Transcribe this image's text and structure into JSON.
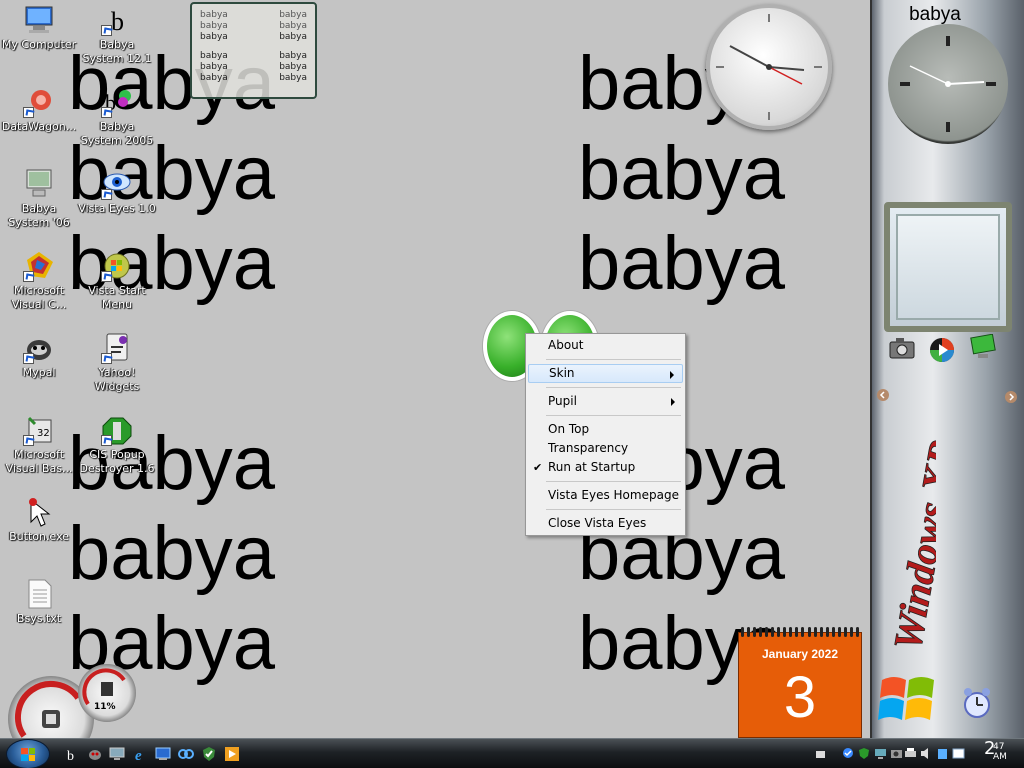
{
  "wallpaper": {
    "word": "babya"
  },
  "desktop_icons": [
    {
      "label": "My Computer",
      "icon": "computer-icon"
    },
    {
      "label": "Babya System 12.1",
      "icon": "babya-icon"
    },
    {
      "label": "DataWagon...",
      "icon": "datawagon-icon"
    },
    {
      "label": "Babya System 2005",
      "icon": "babya-2005-icon"
    },
    {
      "label": "Babya System '06",
      "icon": "babya-06-icon"
    },
    {
      "label": "Vista Eyes 1.0",
      "icon": "vista-eyes-icon"
    },
    {
      "label": "Microsoft Visual C...",
      "icon": "visual-c-icon"
    },
    {
      "label": "Vista Start Menu",
      "icon": "vista-start-menu-icon"
    },
    {
      "label": "Mypal",
      "icon": "mypal-icon"
    },
    {
      "label": "Yahoo! Widgets",
      "icon": "yahoo-widgets-icon"
    },
    {
      "label": "Microsoft Visual Bas...",
      "icon": "visual-basic-icon"
    },
    {
      "label": "CIS Popup Destroyer 1.6",
      "icon": "popup-destroyer-icon"
    },
    {
      "label": "Button.exe",
      "icon": "button-exe-icon"
    },
    {
      "label": "Bsys.txt",
      "icon": "text-file-icon"
    }
  ],
  "text_widget": {
    "rows": [
      [
        "babya",
        "babya"
      ],
      [
        "babya",
        "babya"
      ],
      [
        "babya",
        "babya"
      ],
      [
        "babya",
        "babya"
      ],
      [
        "babya",
        "babya"
      ],
      [
        "babya",
        "babya"
      ]
    ]
  },
  "sidebar": {
    "title": "babya"
  },
  "calendar": {
    "month": "January 2022",
    "day": "3"
  },
  "context_menu": {
    "items": [
      {
        "label": "About",
        "submenu": false,
        "checked": false,
        "highlighted": false
      },
      {
        "label": "Skin",
        "submenu": true,
        "checked": false,
        "highlighted": true
      },
      {
        "label": "Pupil",
        "submenu": true,
        "checked": false,
        "highlighted": false
      },
      {
        "label": "On Top",
        "submenu": false,
        "checked": false,
        "highlighted": false
      },
      {
        "label": "Transparency",
        "submenu": false,
        "checked": false,
        "highlighted": false
      },
      {
        "label": "Run at Startup",
        "submenu": false,
        "checked": true,
        "highlighted": false
      },
      {
        "label": "Vista Eyes Homepage",
        "submenu": false,
        "checked": false,
        "highlighted": false
      },
      {
        "label": "Close Vista Eyes",
        "submenu": false,
        "checked": false,
        "highlighted": false
      }
    ],
    "check_glyph": "✔"
  },
  "gadgets": {
    "cpu_meter_percent": "11%"
  },
  "taskbar": {
    "clock_hour": "2",
    "clock_minutes": "47",
    "clock_ampm": "AM"
  },
  "colors": {
    "calendar_orange": "#e65d08",
    "eye_green": "#38b02a",
    "menu_highlight": "#d7e8fb"
  }
}
